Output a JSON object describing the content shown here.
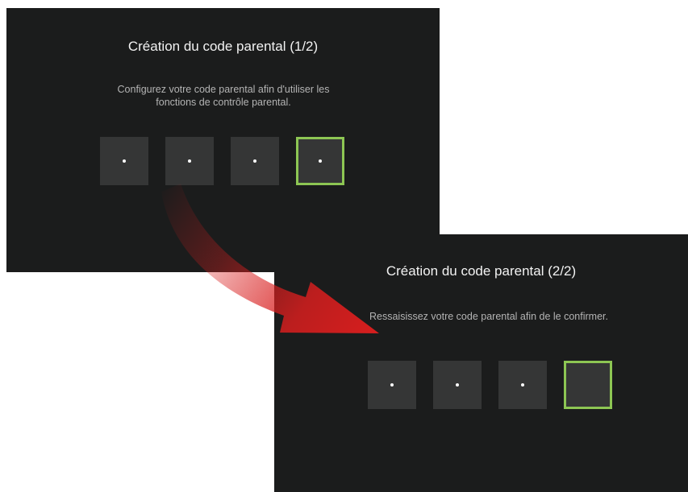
{
  "screen_1": {
    "title": "Création du code parental (1/2)",
    "description": "Configurez votre code parental afin d'utiliser les fonctions de contrôle parental.",
    "pin_boxes": [
      {
        "filled": true,
        "focused": false
      },
      {
        "filled": true,
        "focused": false
      },
      {
        "filled": true,
        "focused": false
      },
      {
        "filled": true,
        "focused": true
      }
    ]
  },
  "screen_2": {
    "title": "Création du code parental (2/2)",
    "description": "Ressaisissez votre code parental afin de le confirmer.",
    "pin_boxes": [
      {
        "filled": true,
        "focused": false
      },
      {
        "filled": true,
        "focused": false
      },
      {
        "filled": true,
        "focused": false
      },
      {
        "filled": false,
        "focused": true
      }
    ]
  },
  "colors": {
    "screen_background": "#1b1c1c",
    "pin_box": "#353636",
    "focus_border": "#8dc653",
    "arrow": "#d81e1e"
  },
  "icons": {
    "transition": "red-curved-arrow-icon"
  }
}
